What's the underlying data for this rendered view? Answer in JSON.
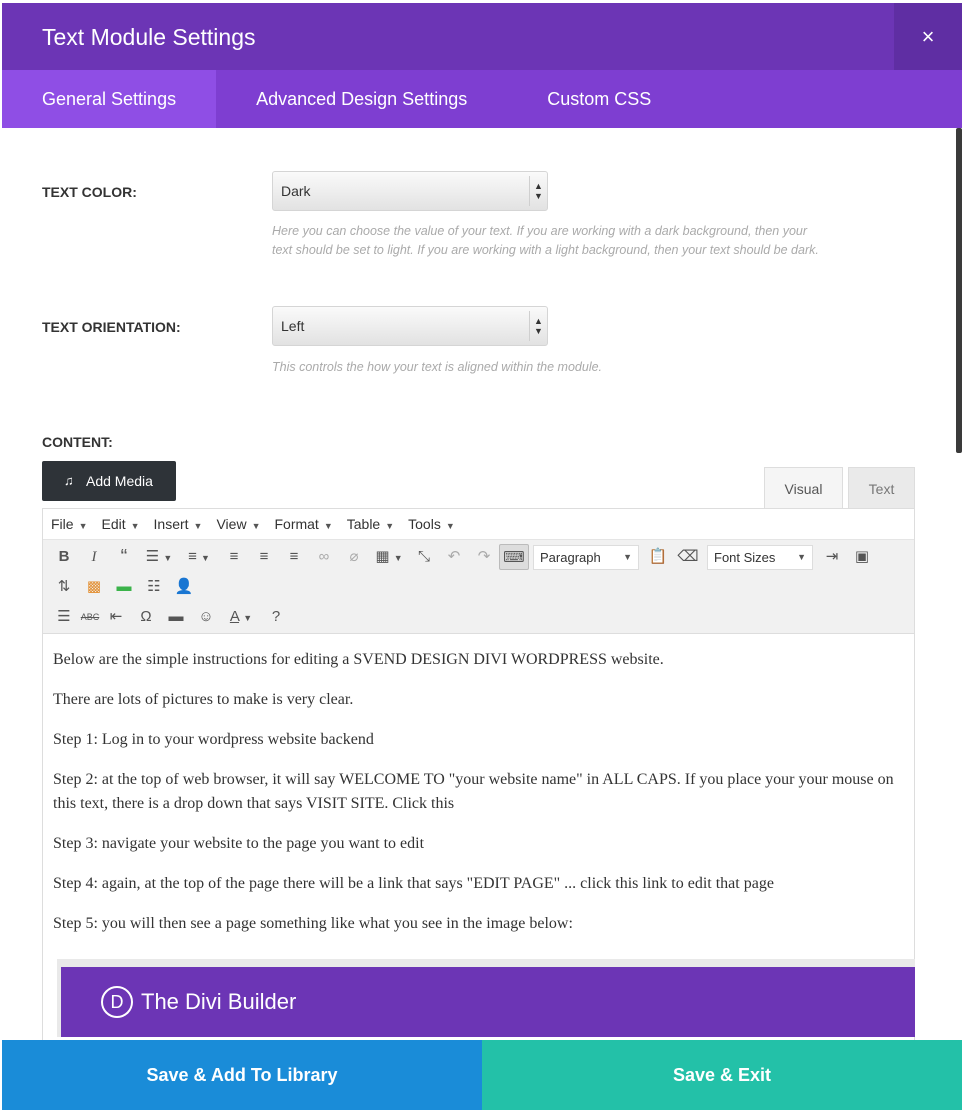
{
  "header": {
    "title": "Text Module Settings",
    "close_icon": "×"
  },
  "tabs": [
    {
      "label": "General Settings"
    },
    {
      "label": "Advanced Design Settings"
    },
    {
      "label": "Custom CSS"
    }
  ],
  "fields": {
    "text_color": {
      "label": "TEXT COLOR:",
      "value": "Dark",
      "description_line1": "Here you can choose the value of your text. If you are working with a dark background, then your",
      "description_line2": "text should be set to light. If you are working with a light background, then your text should be dark."
    },
    "text_orientation": {
      "label": "TEXT ORIENTATION:",
      "value": "Left",
      "description": "This controls the how your text is aligned within the module."
    },
    "content_label": "CONTENT:"
  },
  "editor": {
    "add_media": "Add Media",
    "tab_visual": "Visual",
    "tab_text": "Text",
    "menu": [
      "File",
      "Edit",
      "Insert",
      "View",
      "Format",
      "Table",
      "Tools"
    ],
    "paragraph_select": "Paragraph",
    "font_sizes_select": "Font Sizes",
    "paragraphs": [
      "Below are the simple instructions for editing a SVEND DESIGN DIVI WORDPRESS website.",
      "There are lots of pictures to make is very clear.",
      "Step 1: Log in to your wordpress website backend",
      "Step 2: at the top of web browser, it will say WELCOME TO \"your website name\" in ALL CAPS. If you place your your mouse on this text, there is a drop down that says VISIT SITE. Click this",
      "Step 3: navigate your website to the page you want to edit",
      "Step 4: again, at the top of the page there will be a link that says \"EDIT PAGE\" ... click this link to edit that page",
      "Step 5: you will then see a page something like what you see in the image below:"
    ],
    "embedded_image": {
      "logo_letter": "D",
      "title": "The Divi Builder"
    }
  },
  "footer": {
    "save_library": "Save & Add To Library",
    "save_exit": "Save & Exit"
  },
  "colors": {
    "header": "#6c35b5",
    "tabs": "#7e3ed1",
    "tab_active": "#8f4ee5",
    "save_library": "#1a8cd8",
    "save_exit": "#23c1a8"
  }
}
